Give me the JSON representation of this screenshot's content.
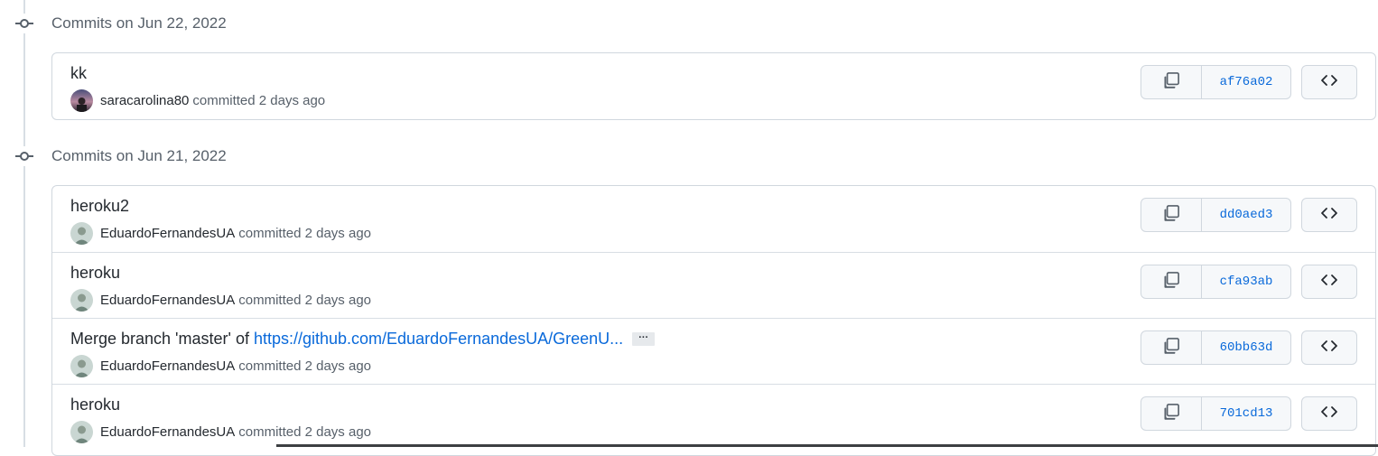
{
  "groups": [
    {
      "title": "Commits on Jun 22, 2022",
      "commits": [
        {
          "message": "kk",
          "link": "",
          "author": "saracarolina80",
          "committed": "committed 2 days ago",
          "sha": "af76a02"
        }
      ]
    },
    {
      "title": "Commits on Jun 21, 2022",
      "commits": [
        {
          "message": "heroku2",
          "link": "",
          "author": "EduardoFernandesUA",
          "committed": "committed 2 days ago",
          "sha": "dd0aed3"
        },
        {
          "message": "heroku",
          "link": "",
          "author": "EduardoFernandesUA",
          "committed": "committed 2 days ago",
          "sha": "cfa93ab"
        },
        {
          "message": "Merge branch 'master' of",
          "link": "https://github.com/EduardoFernandesUA/GreenU...",
          "ellipsis": "···",
          "author": "EduardoFernandesUA",
          "committed": "committed 2 days ago",
          "sha": "60bb63d"
        },
        {
          "message": "heroku",
          "link": "",
          "author": "EduardoFernandesUA",
          "committed": "committed 2 days ago",
          "sha": "701cd13"
        }
      ]
    }
  ],
  "icons": {
    "timeline": "git-commit-icon",
    "copy": "copy-icon",
    "browse": "code-icon"
  },
  "colors": {
    "link": "#0969da",
    "muted": "#57606a",
    "border": "#d0d7de"
  }
}
